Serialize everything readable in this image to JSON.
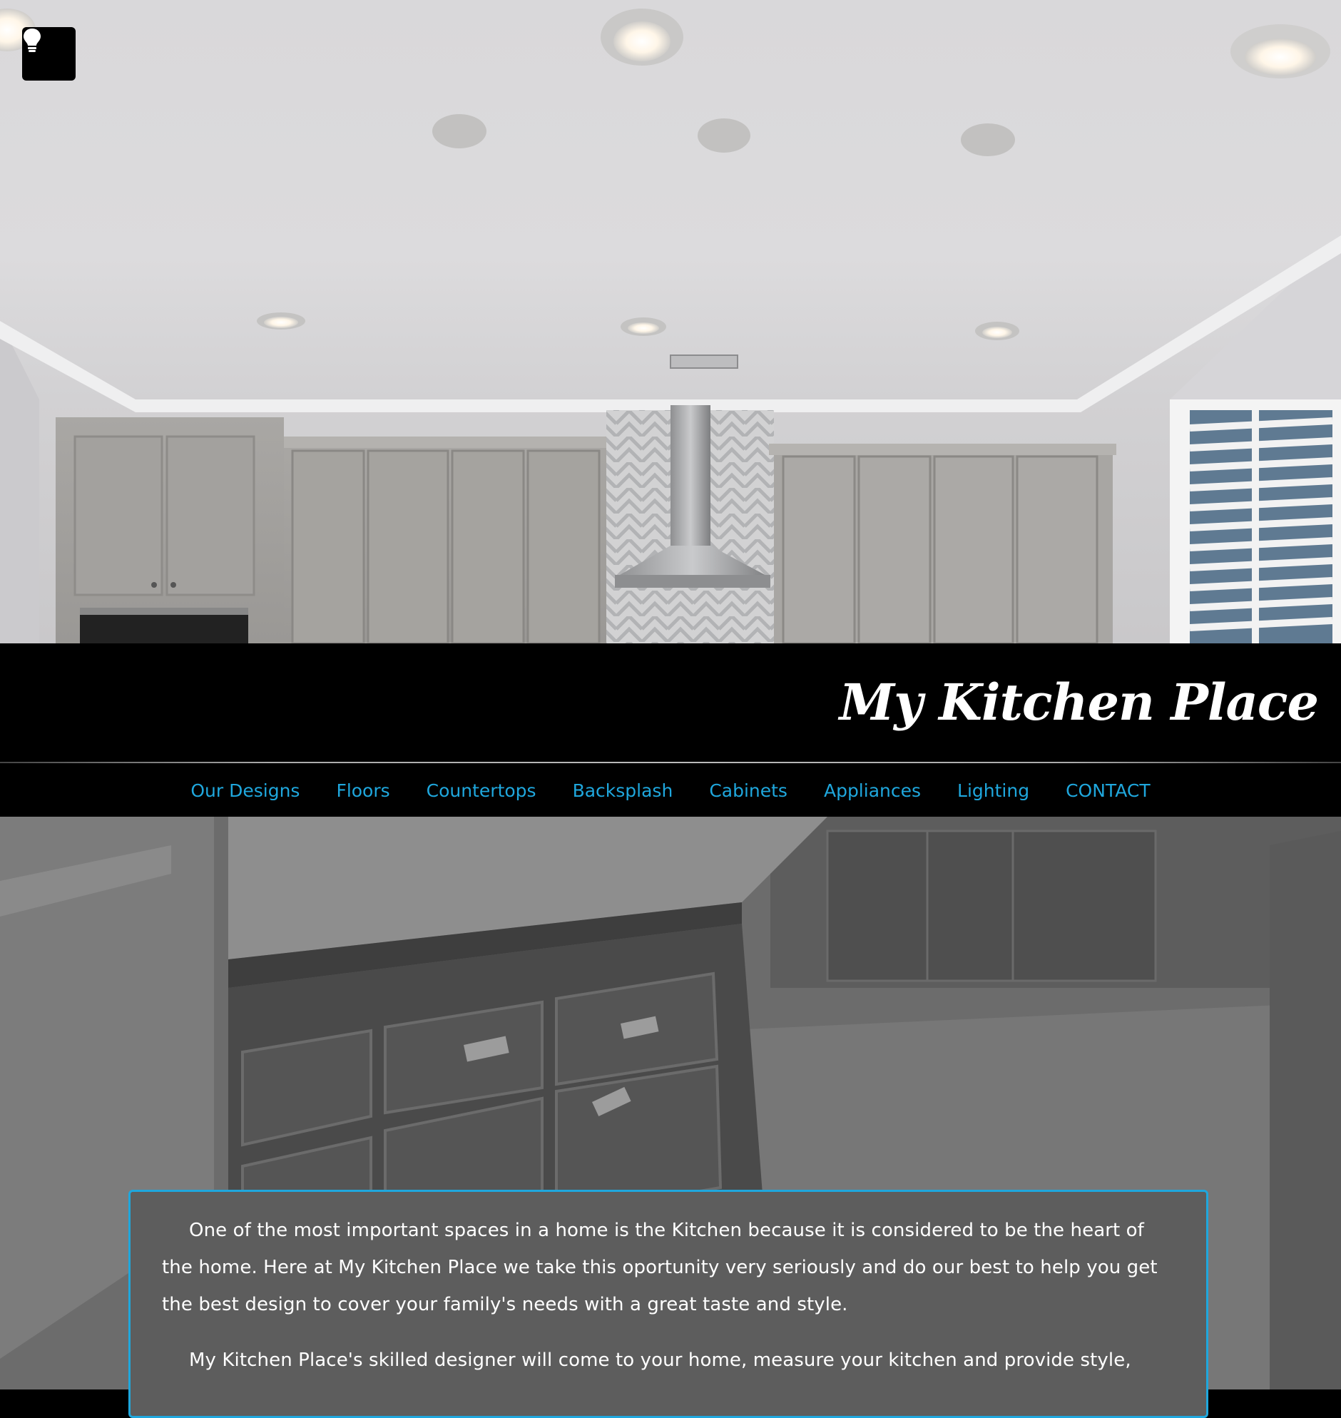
{
  "header": {
    "brand_title": "My Kitchen Place",
    "theme_toggle_icon": "lightbulb-icon"
  },
  "nav": {
    "items": [
      {
        "label": "Our Designs"
      },
      {
        "label": "Floors"
      },
      {
        "label": "Countertops"
      },
      {
        "label": "Backsplash"
      },
      {
        "label": "Cabinets"
      },
      {
        "label": "Appliances"
      },
      {
        "label": "Lighting"
      },
      {
        "label": "CONTACT"
      }
    ]
  },
  "intro": {
    "paragraphs": [
      "One of the most important spaces in a home is the Kitchen because it is considered to be the heart of the home. Here at My Kitchen Place we take this oportunity very seriously and do our best to help you get the best design to cover your family's needs with a great taste and style.",
      "My Kitchen Place's skilled designer will come to your home, measure your kitchen and provide style,"
    ]
  },
  "colors": {
    "accent": "#1fa7dd",
    "header_background": "#000000",
    "card_background": "#5d5d5d",
    "text": "#ffffff"
  }
}
